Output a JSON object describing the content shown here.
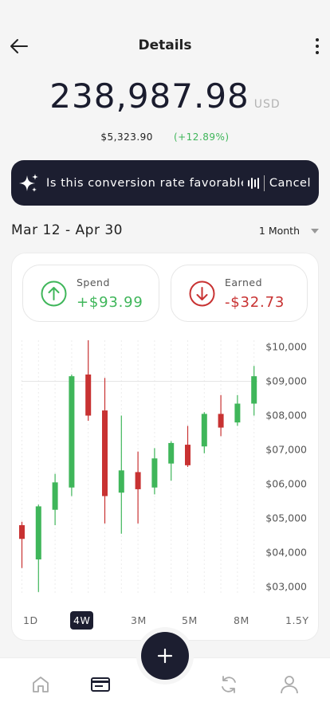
{
  "header": {
    "title": "Details"
  },
  "balance": {
    "amount": "238,987.98",
    "currency": "USD"
  },
  "change": {
    "value": "$5,323.90",
    "percent": "(+12.89%)"
  },
  "assistant": {
    "question": "Is this conversion rate favorable...",
    "cancel_label": "Cancel"
  },
  "range": {
    "label": "Mar 12 - Apr 30",
    "period": "1 Month"
  },
  "stats": {
    "spend": {
      "label": "Spend",
      "value": "+$93.99"
    },
    "earned": {
      "label": "Earned",
      "value": "-$32.73"
    }
  },
  "timeframes": [
    "1D",
    "4W",
    "3M",
    "5M",
    "8M",
    "1.5Y"
  ],
  "active_timeframe": "4W",
  "colors": {
    "up": "#3fb65a",
    "down": "#c83232",
    "dark": "#1c1e30"
  },
  "nav": {
    "items": [
      "home-icon",
      "card-icon",
      "refresh-icon",
      "profile-icon"
    ],
    "active": "card-icon"
  },
  "chart_data": {
    "type": "candlestick",
    "ylim": [
      2800,
      10200
    ],
    "y_ticks": [
      "$10,000",
      "$09,000",
      "$08,000",
      "$07,000",
      "$06,000",
      "$05,000",
      "$04,000",
      "$03,000"
    ],
    "reference_line": 9000,
    "series": [
      {
        "open": 4800,
        "close": 4400,
        "high": 4900,
        "low": 3550
      },
      {
        "open": 3800,
        "close": 5350,
        "high": 5400,
        "low": 2850
      },
      {
        "open": 5250,
        "close": 6050,
        "high": 6300,
        "low": 4800
      },
      {
        "open": 5900,
        "close": 9150,
        "high": 9200,
        "low": 5650
      },
      {
        "open": 9200,
        "close": 8000,
        "high": 10200,
        "low": 7850
      },
      {
        "open": 8150,
        "close": 5650,
        "high": 9100,
        "low": 4850
      },
      {
        "open": 5750,
        "close": 6400,
        "high": 8000,
        "low": 4550
      },
      {
        "open": 6350,
        "close": 5850,
        "high": 6950,
        "low": 4850
      },
      {
        "open": 5900,
        "close": 6750,
        "high": 7050,
        "low": 5700
      },
      {
        "open": 6600,
        "close": 7200,
        "high": 7250,
        "low": 6100
      },
      {
        "open": 7150,
        "close": 6550,
        "high": 7700,
        "low": 6500
      },
      {
        "open": 7100,
        "close": 8050,
        "high": 8100,
        "low": 6900
      },
      {
        "open": 8050,
        "close": 7650,
        "high": 8600,
        "low": 7400
      },
      {
        "open": 7800,
        "close": 8350,
        "high": 8600,
        "low": 7700
      },
      {
        "open": 8350,
        "close": 9150,
        "high": 9450,
        "low": 8000
      }
    ]
  }
}
